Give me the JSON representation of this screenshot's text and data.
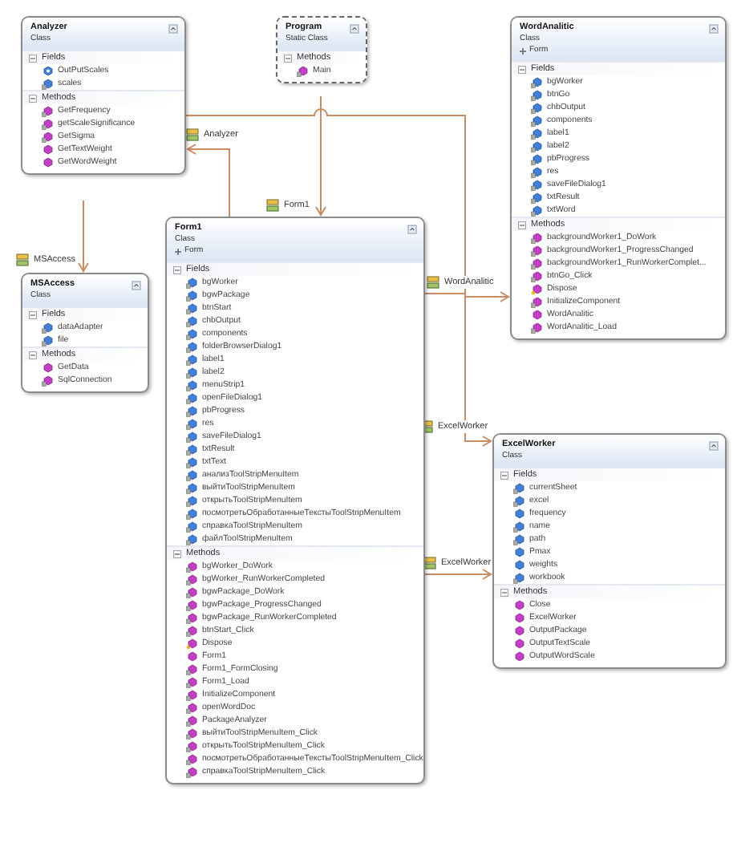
{
  "classes": [
    {
      "name": "Analyzer",
      "stereotype": "Class",
      "sections": [
        {
          "title": "Fields",
          "expanded": true,
          "members": [
            {
              "name": "OutPutScales",
              "kind": "property"
            },
            {
              "name": "scales",
              "kind": "private-field"
            }
          ]
        },
        {
          "title": "Methods",
          "expanded": true,
          "members": [
            {
              "name": "GetFrequency",
              "kind": "private-method"
            },
            {
              "name": "getScaleSignificance",
              "kind": "private-method"
            },
            {
              "name": "GetSigma",
              "kind": "private-method"
            },
            {
              "name": "GetTextWeight",
              "kind": "method"
            },
            {
              "name": "GetWordWeight",
              "kind": "method"
            }
          ]
        }
      ]
    },
    {
      "name": "Program",
      "stereotype": "Static Class",
      "static": true,
      "sections": [
        {
          "title": "Methods",
          "expanded": true,
          "members": [
            {
              "name": "Main",
              "kind": "private-method"
            }
          ]
        }
      ]
    },
    {
      "name": "WordAnalitic",
      "stereotype": "Class",
      "base": "Form",
      "sections": [
        {
          "title": "Fields",
          "expanded": true,
          "members": [
            {
              "name": "bgWorker",
              "kind": "private-field"
            },
            {
              "name": "btnGo",
              "kind": "private-field"
            },
            {
              "name": "chbOutput",
              "kind": "private-field"
            },
            {
              "name": "components",
              "kind": "private-field"
            },
            {
              "name": "label1",
              "kind": "private-field"
            },
            {
              "name": "label2",
              "kind": "private-field"
            },
            {
              "name": "pbProgress",
              "kind": "private-field"
            },
            {
              "name": "res",
              "kind": "private-field"
            },
            {
              "name": "saveFileDialog1",
              "kind": "private-field"
            },
            {
              "name": "txtResult",
              "kind": "private-field"
            },
            {
              "name": "txtWord",
              "kind": "private-field"
            }
          ]
        },
        {
          "title": "Methods",
          "expanded": true,
          "members": [
            {
              "name": "backgroundWorker1_DoWork",
              "kind": "private-method"
            },
            {
              "name": "backgroundWorker1_ProgressChanged",
              "kind": "private-method"
            },
            {
              "name": "backgroundWorker1_RunWorkerComplet...",
              "kind": "private-method"
            },
            {
              "name": "btnGo_Click",
              "kind": "private-method"
            },
            {
              "name": "Dispose",
              "kind": "protected-method"
            },
            {
              "name": "InitializeComponent",
              "kind": "private-method"
            },
            {
              "name": "WordAnalitic",
              "kind": "method"
            },
            {
              "name": "WordAnalitic_Load",
              "kind": "private-method"
            }
          ]
        }
      ]
    },
    {
      "name": "MSAccess",
      "stereotype": "Class",
      "sections": [
        {
          "title": "Fields",
          "expanded": true,
          "members": [
            {
              "name": "dataAdapter",
              "kind": "private-field"
            },
            {
              "name": "file",
              "kind": "private-field"
            }
          ]
        },
        {
          "title": "Methods",
          "expanded": true,
          "members": [
            {
              "name": "GetData",
              "kind": "method"
            },
            {
              "name": "SqlConnection",
              "kind": "private-method"
            }
          ]
        }
      ]
    },
    {
      "name": "Form1",
      "stereotype": "Class",
      "base": "Form",
      "sections": [
        {
          "title": "Fields",
          "expanded": true,
          "members": [
            {
              "name": "bgWorker",
              "kind": "private-field"
            },
            {
              "name": "bgwPackage",
              "kind": "private-field"
            },
            {
              "name": "btnStart",
              "kind": "private-field"
            },
            {
              "name": "chbOutput",
              "kind": "private-field"
            },
            {
              "name": "components",
              "kind": "private-field"
            },
            {
              "name": "folderBrowserDialog1",
              "kind": "private-field"
            },
            {
              "name": "label1",
              "kind": "private-field"
            },
            {
              "name": "label2",
              "kind": "private-field"
            },
            {
              "name": "menuStrip1",
              "kind": "private-field"
            },
            {
              "name": "openFileDialog1",
              "kind": "private-field"
            },
            {
              "name": "pbProgress",
              "kind": "private-field"
            },
            {
              "name": "res",
              "kind": "private-field"
            },
            {
              "name": "saveFileDialog1",
              "kind": "private-field"
            },
            {
              "name": "txtResult",
              "kind": "private-field"
            },
            {
              "name": "txtText",
              "kind": "private-field"
            },
            {
              "name": "анализToolStripMenuItem",
              "kind": "private-field"
            },
            {
              "name": "выйтиToolStripMenuItem",
              "kind": "private-field"
            },
            {
              "name": "открытьToolStripMenuItem",
              "kind": "private-field"
            },
            {
              "name": "посмотретьОбработанныеТекстыToolStripMenuItem",
              "kind": "private-field"
            },
            {
              "name": "справкаToolStripMenuItem",
              "kind": "private-field"
            },
            {
              "name": "файлToolStripMenuItem",
              "kind": "private-field"
            }
          ]
        },
        {
          "title": "Methods",
          "expanded": true,
          "members": [
            {
              "name": "bgWorker_DoWork",
              "kind": "private-method"
            },
            {
              "name": "bgWorker_RunWorkerCompleted",
              "kind": "private-method"
            },
            {
              "name": "bgwPackage_DoWork",
              "kind": "private-method"
            },
            {
              "name": "bgwPackage_ProgressChanged",
              "kind": "private-method"
            },
            {
              "name": "bgwPackage_RunWorkerCompleted",
              "kind": "private-method"
            },
            {
              "name": "btnStart_Click",
              "kind": "private-method"
            },
            {
              "name": "Dispose",
              "kind": "protected-method"
            },
            {
              "name": "Form1",
              "kind": "method"
            },
            {
              "name": "Form1_FormClosing",
              "kind": "private-method"
            },
            {
              "name": "Form1_Load",
              "kind": "private-method"
            },
            {
              "name": "InitializeComponent",
              "kind": "private-method"
            },
            {
              "name": "openWordDoc",
              "kind": "private-method"
            },
            {
              "name": "PackageAnalyzer",
              "kind": "private-method"
            },
            {
              "name": "выйтиToolStripMenuItem_Click",
              "kind": "private-method"
            },
            {
              "name": "открытьToolStripMenuItem_Click",
              "kind": "private-method"
            },
            {
              "name": "посмотретьОбработанныеТекстыToolStripMenuItem_Click",
              "kind": "private-method"
            },
            {
              "name": "справкаToolStripMenuItem_Click",
              "kind": "private-method"
            }
          ]
        }
      ]
    },
    {
      "name": "ExcelWorker",
      "stereotype": "Class",
      "sections": [
        {
          "title": "Fields",
          "expanded": true,
          "members": [
            {
              "name": "currentSheet",
              "kind": "private-field"
            },
            {
              "name": "excel",
              "kind": "private-field"
            },
            {
              "name": "frequency",
              "kind": "field"
            },
            {
              "name": "name",
              "kind": "private-field"
            },
            {
              "name": "path",
              "kind": "private-field"
            },
            {
              "name": "Pmax",
              "kind": "field"
            },
            {
              "name": "weights",
              "kind": "field"
            },
            {
              "name": "workbook",
              "kind": "private-field"
            }
          ]
        },
        {
          "title": "Methods",
          "expanded": true,
          "members": [
            {
              "name": "Close",
              "kind": "method"
            },
            {
              "name": "ExcelWorker",
              "kind": "method"
            },
            {
              "name": "OutputPackage",
              "kind": "method"
            },
            {
              "name": "OutputTextScale",
              "kind": "method"
            },
            {
              "name": "OutputWordScale",
              "kind": "method"
            }
          ]
        }
      ]
    }
  ],
  "associations": [
    {
      "label": "Analyzer"
    },
    {
      "label": "Form1"
    },
    {
      "label": "MSAccess"
    },
    {
      "label": "WordAnalitic"
    },
    {
      "label": "ExcelWorker"
    },
    {
      "label": "ExcelWorker"
    }
  ]
}
